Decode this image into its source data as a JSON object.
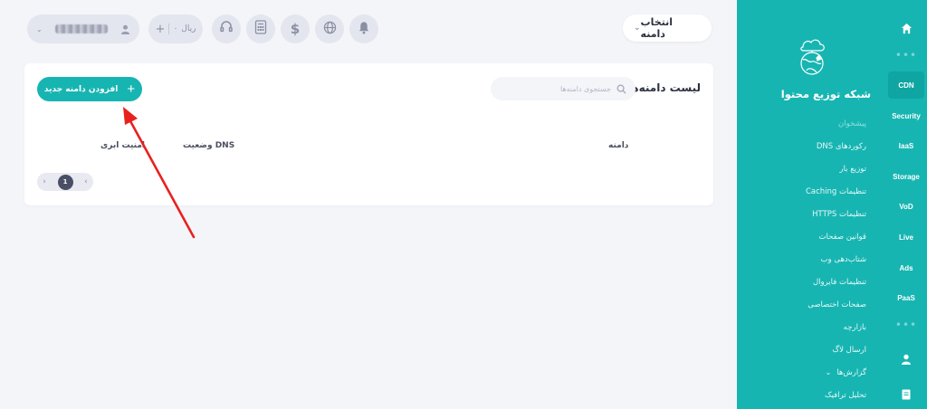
{
  "topbar": {
    "domain_select_label": "انتخاب دامنه",
    "wallet_amount": "۰",
    "wallet_currency": "ریال",
    "wallet_plus": "+",
    "icons": [
      "user-icon",
      "headset-icon",
      "calculator-icon",
      "dollar-icon",
      "globe-icon",
      "bell-icon",
      "chevron-down-icon"
    ]
  },
  "card": {
    "title": "لیست دامنه‌ها",
    "search_placeholder": "جستجوی دامنه‌ها",
    "add_button_label": "افزودن دامنه جدید",
    "add_button_icon": "+",
    "columns": {
      "domain": "دامنه",
      "dns_status": "وضعیت DNS",
      "cloud_security": "امنیت ابری"
    },
    "pagination": {
      "current_page": "1",
      "prev": "‹",
      "next": "›"
    }
  },
  "submenu": {
    "section_title": "شبکه توزیع محتوا",
    "items": [
      {
        "label": "پیشخوان",
        "muted": true
      },
      {
        "label": "رکوردهای DNS",
        "muted": false
      },
      {
        "label": "توزیع بار",
        "muted": false
      },
      {
        "label": "تنظیمات Caching",
        "muted": false
      },
      {
        "label": "تنظیمات HTTPS",
        "muted": false
      },
      {
        "label": "قوانین صفحات",
        "muted": false
      },
      {
        "label": "شتاب‌دهی وب",
        "muted": false
      },
      {
        "label": "تنظیمات فایروال",
        "muted": false
      },
      {
        "label": "صفحات اختصاصی",
        "muted": false
      },
      {
        "label": "بازارچه",
        "muted": false
      },
      {
        "label": "ارسال لاگ",
        "muted": false
      },
      {
        "label": "گزارش‌ها",
        "muted": false
      },
      {
        "label": "تحلیل ترافیک",
        "muted": false
      }
    ]
  },
  "iconbar": {
    "items": [
      "CDN",
      "Security",
      "IaaS",
      "Storage",
      "VoD",
      "Live",
      "Ads",
      "PaaS"
    ],
    "dots": "•••",
    "active": "CDN"
  },
  "colors": {
    "brand_teal": "#17b5b2",
    "annotation_red": "#e8211f",
    "page_bg": "#f4f5f9"
  }
}
